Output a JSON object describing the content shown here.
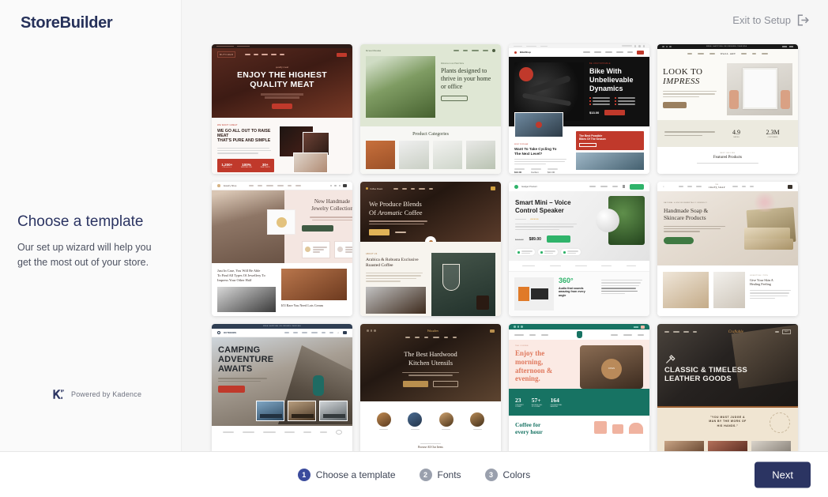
{
  "header": {
    "brand": "StoreBuilder",
    "exit_label": "Exit to Setup",
    "exit_icon": "exit-arrow-icon"
  },
  "sidebar": {
    "title": "Choose a template",
    "subtitle": "Our set up wizard will help you get the most out of your store.",
    "powered_by": "Powered by Kadence",
    "powered_icon": "kadence-logo-icon"
  },
  "footer": {
    "steps": [
      {
        "num": "1",
        "label": "Choose a template",
        "active": true
      },
      {
        "num": "2",
        "label": "Fonts",
        "active": false
      },
      {
        "num": "3",
        "label": "Colors",
        "active": false
      }
    ],
    "next_label": "Next"
  },
  "colors": {
    "brand_navy": "#2b3462",
    "step_active": "#3b4b9c",
    "step_inactive": "#9aa0ad",
    "page_bg": "#f6f6f6",
    "sidebar_bg": "#fafafa"
  },
  "templates": [
    {
      "name": "butcher-meat",
      "logo": "BUTCHER",
      "hero_title": "ENJOY THE HIGHEST QUALITY MEAT",
      "hero_eyebrow": "quality meat",
      "cta": "read more",
      "section_eyebrow": "WE WANT GREAT",
      "section_title": "WE GO ALL OUT TO RAISE MEAT THAT'S PURE AND SIMPLE",
      "stats": [
        "1,200+",
        "100%",
        "30+"
      ],
      "stat_labels": [
        "Products",
        "Natural Org",
        "Real Taste"
      ]
    },
    {
      "name": "plant-shop",
      "logo": "Greenhouse",
      "hero_eyebrow": "Welcome to our Plant Store",
      "hero_title": "Plants designed to thrive in your home or office",
      "cta": "Shop Now",
      "section_title": "Product Categories",
      "nav": [
        "Home",
        "Shop",
        "Our Story",
        "About Us"
      ]
    },
    {
      "name": "bike-shop",
      "logo": "BikeShop",
      "hero_eyebrow": "BE UNSTOPPABLE",
      "hero_title": "Bike With Unbelievable Dynamics",
      "price": "$13.00",
      "cta": "Buy Now",
      "features": [
        "EASY TO RIDE ANYWAY",
        "LIGHT WEIGHT FRAME",
        "FAST AND TOUGH TYRES",
        "BUILT FOR SPEED",
        "BEST SEAT CONTROL",
        "SUPER EASY TO USE"
      ],
      "post_eyebrow": "MOST POPULAR",
      "post_title": "Want To Take Cycling To The Next Level?",
      "promo": "The Best Possible Bikes Of The Season",
      "promo_cta": "Shop Now"
    },
    {
      "name": "art-prints",
      "logo": "WALL ART",
      "hero_title_1": "LOOK TO",
      "hero_title_2": "IMPRESS",
      "cta": "SHOP NOW",
      "trust_text": "Trusted by over 20,000+ clients worldwide since 2014",
      "stats": [
        "4.9",
        "2.3M"
      ],
      "stat_labels": [
        "RATING",
        "CUSTOMERS"
      ],
      "section_eyebrow": "BEST SELLING",
      "section_title": "Featured Products",
      "nav": [
        "Home",
        "Shop",
        "About",
        "Blog",
        "FAQ",
        "Contact"
      ]
    },
    {
      "name": "jewelry",
      "logo": "Jewelry Shop",
      "hero_title": "New Handmade Jewelry Collection",
      "cta": "EXPLORE NOW",
      "feature_1": "Free Delivery Over $50",
      "feature_2": "Easy & Free 30 Days Return",
      "post_title": "Just In Case, You Will Be Able To Find All Types Of Jewellery To Impress Your Other Half",
      "post_2_title": "It's Rare You Need Lots Cream",
      "nav": [
        "Home",
        "Shop",
        "Journal",
        "About Us",
        "Sale",
        "Contact"
      ]
    },
    {
      "name": "coffee-roaster",
      "logo": "Coffee Roast",
      "hero_title": "We Produce Blends Of Aromatic Coffee",
      "cta": "SHOP NOW",
      "cta_2": "Read More",
      "section_eyebrow": "ABOUT US",
      "section_title": "Arabica & Robusta Exclusive Roasted Coffee",
      "nav": [
        "Home",
        "Shop",
        "Menu",
        "Contact",
        "FAQ"
      ]
    },
    {
      "name": "smart-speaker",
      "logo": "Gadget Product",
      "hero_title": "Smart Mini – Voice Control Speaker",
      "rating": "4 reviews",
      "stock": "In Stock",
      "price_old": "$119.00",
      "price_new": "$89.00",
      "cta": "Buy Now",
      "features": [
        "VOICE CONTROL ASSISTANT",
        "SMART ON OFF SENSOR",
        "WIRELESS BLUETOOTH CONNECTIVITY"
      ],
      "stat_big": "360°",
      "stat_title": "Audio that sounds amazing from every angle",
      "nav": [
        "Speakers",
        "Features",
        "Pages"
      ]
    },
    {
      "name": "handmade-soap",
      "logo": "CRAFT SOAP",
      "hero_eyebrow": "NATURAL & ENVIRONMENTALLY FRIENDLY",
      "hero_title": "Handmade Soap & Skincare Products",
      "cta": "Shop Soaps",
      "post_eyebrow": "LIFESTYLE / TIPS",
      "post_title": "Give Your Skin A Healing Feeling",
      "nav": [
        "Home",
        "Shop",
        "About",
        "Contact",
        "Blog",
        "FAQ"
      ]
    },
    {
      "name": "camping-outdoors",
      "logo": "OUTDOORS",
      "announcement": "FREE SHIPPING ON ORDERS OVER $50",
      "hero_title": "CAMPING ADVENTURE AWAITS",
      "cta": "SHOP GEAR NOW",
      "categories": [
        "BACKPACKS",
        "CAMPING",
        "ACCESSORIES"
      ],
      "nav": [
        "Home",
        "Shop",
        "About",
        "Contact",
        "FAQ",
        "Blog"
      ]
    },
    {
      "name": "kitchen-utensils",
      "logo": "Wooden",
      "hero_title": "The Best Hardwood Kitchen Utensils",
      "cta": "SHOP NOW",
      "cta_2": "VIEW STORE",
      "products": [
        "Spoons",
        "Boards",
        "Bowls",
        "Sets"
      ],
      "section_title": "Browse All Our Items",
      "nav": [
        "Shop",
        "Home",
        "Sale",
        "Contact",
        "Blog",
        "FAQ"
      ]
    },
    {
      "name": "cafe-coffee-shop",
      "logo": "Cafe",
      "hero_eyebrow": "THE COFFEE",
      "hero_title": "Enjoy the morning, afternoon & evening.",
      "badge": "OPEN",
      "stats": [
        "23",
        "57+",
        "164"
      ],
      "stat_labels": [
        "COFFEE BLENDS ROASTED",
        "RECIPES & ALL OUR COFFEE",
        "PROFESSIONAL BARISTAS"
      ],
      "section_title": "Coffee for every hour",
      "nav": [
        "Coffee Shop",
        "Menu",
        "Our Place",
        "Our Story",
        "Fresh Roasting",
        "Contact"
      ]
    },
    {
      "name": "leather-goods",
      "logo": "Craftable",
      "hero_title": "CLASSIC & TIMELESS LEATHER GOODS",
      "quote": "\"YOU MUST JUDGE A MAN BY THE WORK OF HIS HANDS.\"",
      "nav": [
        "Shop",
        "Our Story",
        "Contact",
        "Blog"
      ],
      "cart": "CART"
    }
  ]
}
